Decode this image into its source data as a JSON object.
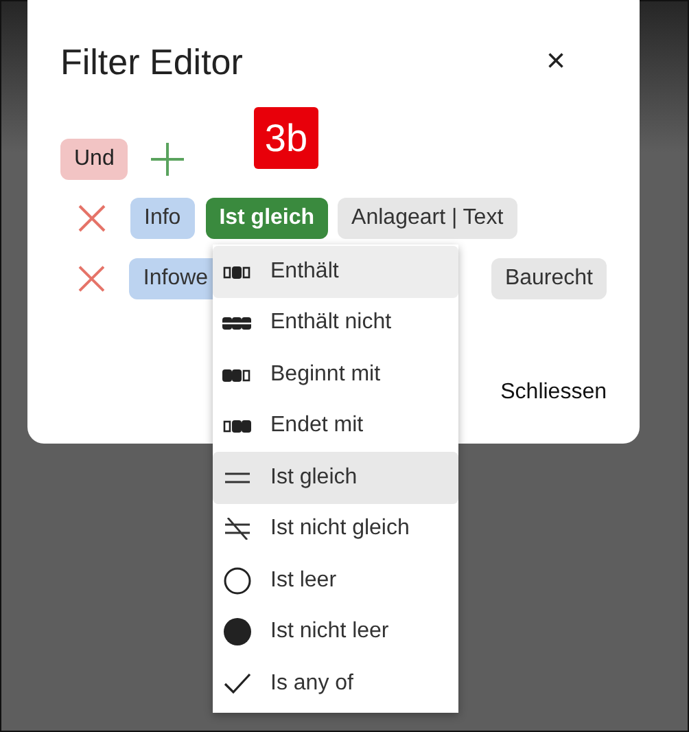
{
  "dialog": {
    "title": "Filter Editor",
    "close": "×",
    "group_operator": "Und",
    "annotation": "3b",
    "conditions": [
      {
        "field": "Info",
        "operator": "Ist gleich",
        "value": "Anlageart | Text"
      },
      {
        "field": "Infowe",
        "value": "Baurecht"
      }
    ],
    "footer_button": "Schliessen"
  },
  "menu": [
    {
      "kind": "contains",
      "label": "Enthält",
      "hovered": true,
      "selected": false
    },
    {
      "kind": "not_contains",
      "label": "Enthält nicht",
      "hovered": false,
      "selected": false
    },
    {
      "kind": "starts_with",
      "label": "Beginnt mit",
      "hovered": false,
      "selected": false
    },
    {
      "kind": "ends_with",
      "label": "Endet mit",
      "hovered": false,
      "selected": false
    },
    {
      "kind": "equals",
      "label": "Ist gleich",
      "hovered": false,
      "selected": true
    },
    {
      "kind": "not_equals",
      "label": "Ist nicht gleich",
      "hovered": false,
      "selected": false
    },
    {
      "kind": "empty",
      "label": "Ist leer",
      "hovered": false,
      "selected": false
    },
    {
      "kind": "not_empty",
      "label": "Ist nicht leer",
      "hovered": false,
      "selected": false
    },
    {
      "kind": "any_of",
      "label": "Is any of",
      "hovered": false,
      "selected": false
    }
  ]
}
